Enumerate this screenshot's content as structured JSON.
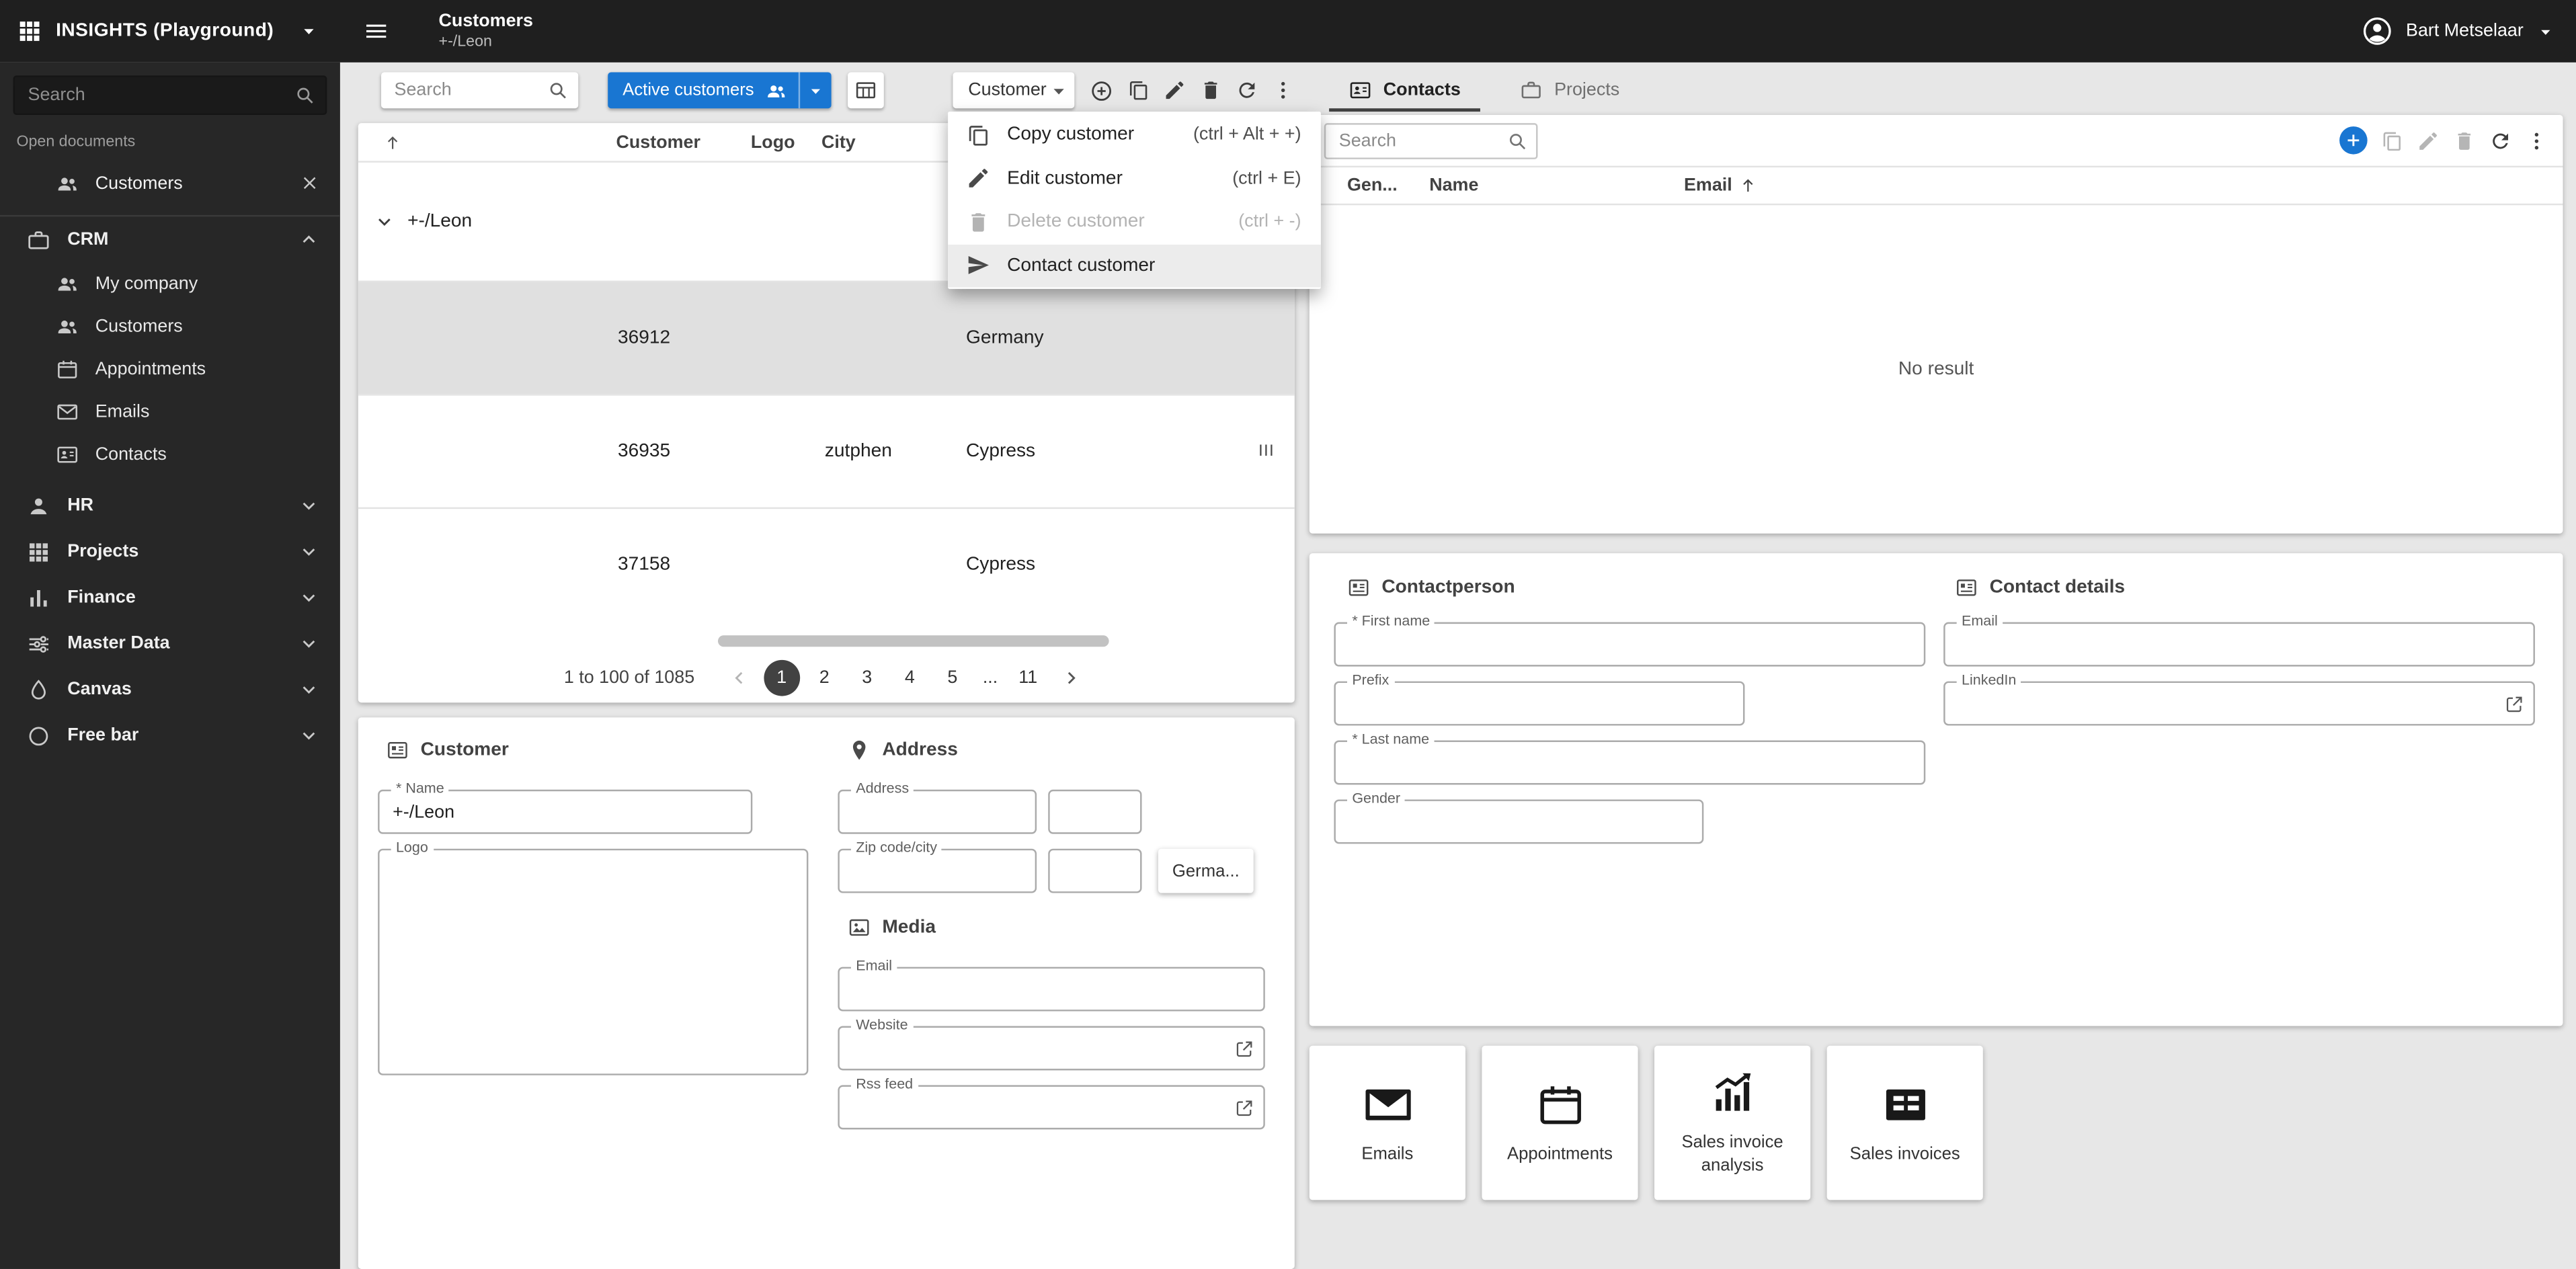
{
  "topbar": {
    "app_name": "INSIGHTS (Playground)",
    "page_title": "Customers",
    "page_subtitle": "+-/Leon",
    "user_name": "Bart Metselaar"
  },
  "sidebar": {
    "search_placeholder": "Search",
    "open_documents_label": "Open documents",
    "open_document": "Customers",
    "sections": [
      {
        "label": "CRM",
        "expanded": true
      },
      {
        "label": "HR",
        "expanded": false
      },
      {
        "label": "Projects",
        "expanded": false
      },
      {
        "label": "Finance",
        "expanded": false
      },
      {
        "label": "Master Data",
        "expanded": false
      },
      {
        "label": "Canvas",
        "expanded": false
      },
      {
        "label": "Free bar",
        "expanded": false
      }
    ],
    "crm_items": [
      {
        "label": "My company"
      },
      {
        "label": "Customers"
      },
      {
        "label": "Appointments"
      },
      {
        "label": "Emails"
      },
      {
        "label": "Contacts"
      }
    ]
  },
  "toolbar": {
    "search_placeholder": "Search",
    "filter_label": "Active customers",
    "entity_label": "Customer"
  },
  "context_menu": {
    "items": [
      {
        "label": "Copy customer",
        "shortcut": "(ctrl + Alt + +)",
        "disabled": false
      },
      {
        "label": "Edit customer",
        "shortcut": "(ctrl + E)",
        "disabled": false
      },
      {
        "label": "Delete customer",
        "shortcut": "(ctrl + -)",
        "disabled": true
      },
      {
        "label": "Contact customer",
        "shortcut": "",
        "disabled": false
      }
    ]
  },
  "customers_table": {
    "columns": {
      "customer": "Customer",
      "logo": "Logo",
      "city": "City"
    },
    "group_label": "+-/Leon",
    "rows": [
      {
        "customer": "36912",
        "city": "",
        "country": "Germany",
        "extra": "",
        "selected": true
      },
      {
        "customer": "36935",
        "city": "zutphen",
        "country": "Cypress",
        "extra": "III",
        "selected": false
      },
      {
        "customer": "37158",
        "city": "",
        "country": "Cypress",
        "extra": "",
        "selected": false
      }
    ],
    "pagination": {
      "summary": "1 to 100 of 1085",
      "pages": [
        "1",
        "2",
        "3",
        "4",
        "5",
        "...",
        "11"
      ],
      "current_page": "1"
    }
  },
  "customer_form": {
    "title": "Customer",
    "name_label": "* Name",
    "name_value": "+-/Leon",
    "logo_label": "Logo",
    "address": {
      "title": "Address",
      "address_label": "Address",
      "zip_city_label": "Zip code/city",
      "country_button": "Germa..."
    },
    "media": {
      "title": "Media",
      "email_label": "Email",
      "website_label": "Website",
      "rss_label": "Rss feed"
    }
  },
  "contacts_panel": {
    "tabs": [
      {
        "label": "Contacts",
        "active": true
      },
      {
        "label": "Projects",
        "active": false
      }
    ],
    "search_placeholder": "Search",
    "columns": {
      "gender": "Gen...",
      "name": "Name",
      "email": "Email"
    },
    "empty_text": "No result",
    "contactperson": {
      "title": "Contactperson",
      "first_name_label": "* First name",
      "prefix_label": "Prefix",
      "last_name_label": "* Last name",
      "gender_label": "Gender"
    },
    "contact_details": {
      "title": "Contact details",
      "email_label": "Email",
      "linkedin_label": "LinkedIn"
    },
    "shortcuts": [
      {
        "label": "Emails"
      },
      {
        "label": "Appointments"
      },
      {
        "label": "Sales invoice analysis"
      },
      {
        "label": "Sales invoices"
      }
    ]
  },
  "colors": {
    "accent": "#1976d2",
    "topbar_bg": "#1f1f1f",
    "sidebar_bg": "#272727",
    "selected_row": "#e0e0e0"
  }
}
